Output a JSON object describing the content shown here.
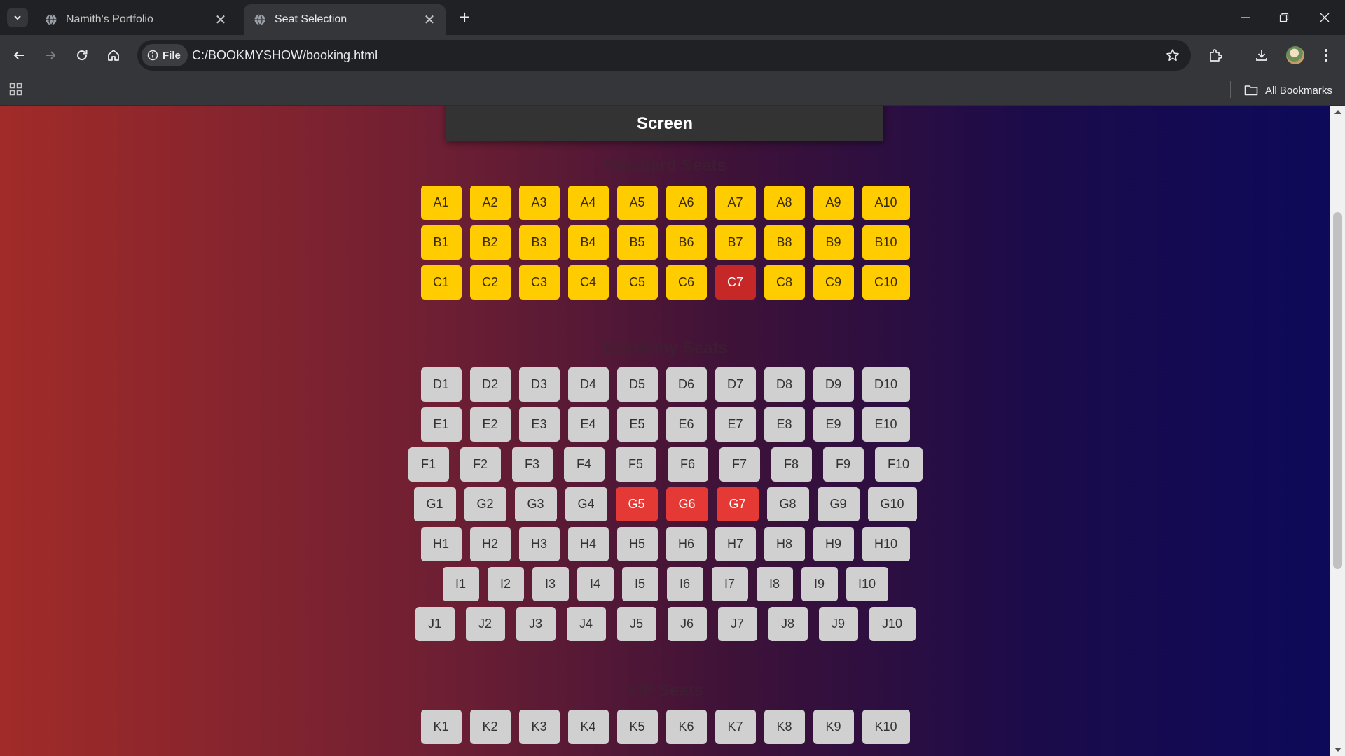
{
  "tabs": [
    {
      "title": "Namith's Portfolio",
      "active": false
    },
    {
      "title": "Seat Selection",
      "active": true
    }
  ],
  "address_bar": {
    "site_info": "File",
    "url": "C:/BOOKMYSHOW/booking.html"
  },
  "bookmarks_bar": {
    "all_bookmarks": "All Bookmarks"
  },
  "page": {
    "screen_label": "Screen",
    "sections": [
      {
        "title": "Standard Seats",
        "rows": [
          {
            "seats": [
              "A1",
              "A2",
              "A3",
              "A4",
              "A5",
              "A6",
              "A7",
              "A8",
              "A9",
              "A10"
            ],
            "booked": []
          },
          {
            "seats": [
              "B1",
              "B2",
              "B3",
              "B4",
              "B5",
              "B6",
              "B7",
              "B8",
              "B9",
              "B10"
            ],
            "booked": []
          },
          {
            "seats": [
              "C1",
              "C2",
              "C3",
              "C4",
              "C5",
              "C6",
              "C7",
              "C8",
              "C9",
              "C10"
            ],
            "booked": [
              "C7"
            ]
          }
        ]
      },
      {
        "title": "Economy Seats",
        "rows": [
          {
            "seats": [
              "D1",
              "D2",
              "D3",
              "D4",
              "D5",
              "D6",
              "D7",
              "D8",
              "D9",
              "D10"
            ],
            "booked": []
          },
          {
            "seats": [
              "E1",
              "E2",
              "E3",
              "E4",
              "E5",
              "E6",
              "E7",
              "E8",
              "E9",
              "E10"
            ],
            "booked": []
          },
          {
            "seats": [
              "F1",
              "F2",
              "F3",
              "F4",
              "F5",
              "F6",
              "F7",
              "F8",
              "F9",
              "F10"
            ],
            "booked": []
          },
          {
            "seats": [
              "G1",
              "G2",
              "G3",
              "G4",
              "G5",
              "G6",
              "G7",
              "G8",
              "G9",
              "G10"
            ],
            "booked": [
              "G5",
              "G6",
              "G7"
            ]
          },
          {
            "seats": [
              "H1",
              "H2",
              "H3",
              "H4",
              "H5",
              "H6",
              "H7",
              "H8",
              "H9",
              "H10"
            ],
            "booked": []
          },
          {
            "seats": [
              "I1",
              "I2",
              "I3",
              "I4",
              "I5",
              "I6",
              "I7",
              "I8",
              "I9",
              "I10"
            ],
            "booked": []
          },
          {
            "seats": [
              "J1",
              "J2",
              "J3",
              "J4",
              "J5",
              "J6",
              "J7",
              "J8",
              "J9",
              "J10"
            ],
            "booked": []
          }
        ]
      },
      {
        "title": "VIP Seats",
        "rows": [
          {
            "seats": [
              "K1",
              "K2",
              "K3",
              "K4",
              "K5",
              "K6",
              "K7",
              "K8",
              "K9",
              "K10"
            ],
            "booked": []
          }
        ]
      }
    ]
  },
  "colors": {
    "standard_seat": "#ffcc00",
    "available_seat": "#d0d0d0",
    "booked_seat": "#e53935",
    "screen": "#333333"
  }
}
